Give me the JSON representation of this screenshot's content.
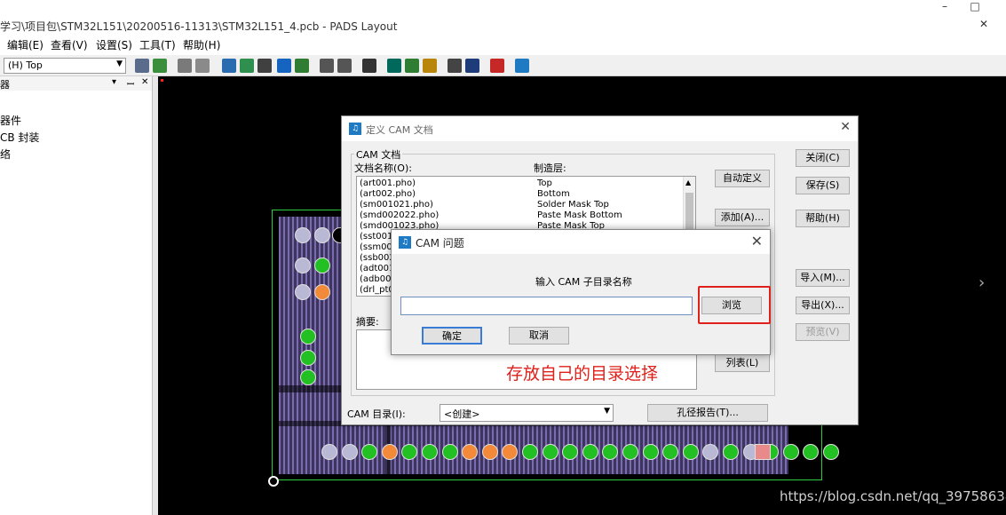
{
  "window": {
    "title": "学习\\项目包\\STM32L151\\20200516-11313\\STM32L151_4.pcb - PADS Layout",
    "minimize": "–",
    "maximize": "□",
    "tab_close": "✕"
  },
  "menu": [
    "编辑(E)",
    "查看(V)",
    "设置(S)",
    "工具(T)",
    "帮助(H)"
  ],
  "toolbar": {
    "layer": "(H) Top",
    "icons": [
      "properties-icon",
      "refresh-icon",
      "print-icon",
      "print-preview-icon",
      "route-icon",
      "components-icon",
      "board-icon",
      "trace-icon",
      "via-icon",
      "undo-icon",
      "redo-icon",
      "zoom-icon",
      "view-icon",
      "layers-icon",
      "brush-icon",
      "report-icon",
      "output-icon",
      "check-icon",
      "design-icon"
    ]
  },
  "left_panel": {
    "title": "器",
    "ctl_pin": "▾",
    "ctl_dock": "ꟷ",
    "ctl_close": "✕",
    "items": [
      "器件",
      "CB 封装",
      "络"
    ]
  },
  "canvas": {
    "watermark": "https://blog.csdn.net/qq_39758638",
    "next_arrow": "›"
  },
  "cam_dialog": {
    "title": "定义 CAM 文档",
    "close": "✕",
    "group_title": "CAM 文档",
    "col_name": "文档名称(O):",
    "col_layer": "制造层:",
    "documents": [
      {
        "name": "(art001.pho)",
        "layer": "Top"
      },
      {
        "name": "(art002.pho)",
        "layer": "Bottom"
      },
      {
        "name": "(sm001021.pho)",
        "layer": "Solder Mask Top"
      },
      {
        "name": "(smd002022.pho)",
        "layer": "Paste Mask Bottom"
      },
      {
        "name": "(smd001023.pho)",
        "layer": "Paste Mask Top"
      },
      {
        "name": "(sst0010",
        "layer": ""
      },
      {
        "name": "(ssm0020",
        "layer": ""
      },
      {
        "name": "(ssb0020",
        "layer": ""
      },
      {
        "name": "(adt0010",
        "layer": ""
      },
      {
        "name": "(adb002",
        "layer": ""
      },
      {
        "name": "(drl_pt00",
        "layer": ""
      }
    ],
    "summary_label": "摘要:",
    "cam_dir_label": "CAM 目录(I):",
    "cam_dir_value": "<创建>",
    "buttons": {
      "auto_define": "自动定义",
      "add": "添加(A)...",
      "list": "列表(L)",
      "drill_report": "孔径报告(T)...",
      "close": "关闭(C)",
      "save": "保存(S)",
      "help": "帮助(H)",
      "import": "导入(M)...",
      "export": "导出(X)...",
      "preview": "预览(V)"
    }
  },
  "question_dialog": {
    "title": "CAM 问题",
    "close": "✕",
    "prompt": "输入 CAM 子目录名称",
    "input_value": "",
    "browse": "浏览",
    "ok": "确定",
    "cancel": "取消"
  },
  "annotation": "存放自己的目录选择",
  "colors": {
    "highlight": "#e0201a",
    "board_outline": "#2ecc40",
    "canvas_bg": "#000000",
    "pad_green": "#22c022",
    "pad_orange": "#f28a3a",
    "pad_gray": "#b9b9d6",
    "pad_pink": "#e88a8a"
  }
}
